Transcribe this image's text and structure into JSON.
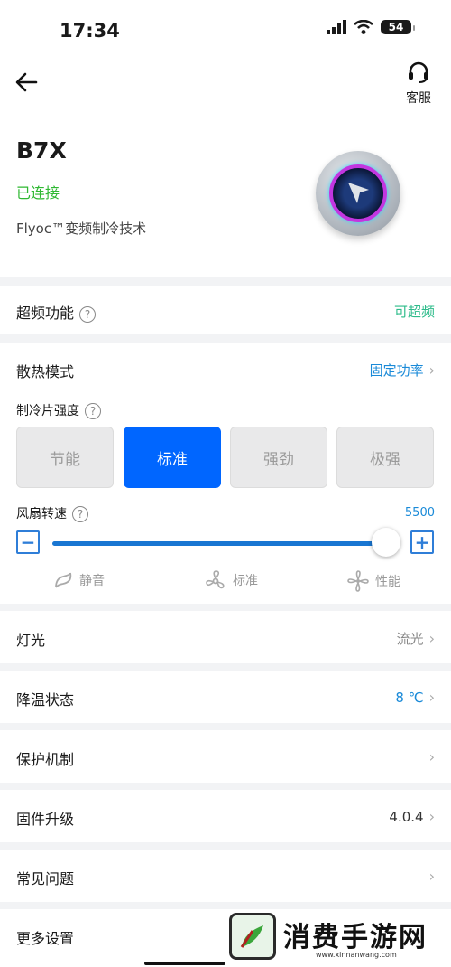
{
  "status_bar": {
    "time": "17:34",
    "battery": "54"
  },
  "header": {
    "service_label": "客服",
    "device_name": "B7X",
    "connection_status": "已连接",
    "tech_label": "Flyoc™变频制冷技术"
  },
  "overclock": {
    "label": "超频功能",
    "value": "可超频",
    "value_color": "#2dbb8a"
  },
  "cooling": {
    "mode_label": "散热模式",
    "mode_value": "固定功率",
    "strength_label": "制冷片强度",
    "strength_options": [
      "节能",
      "标准",
      "强劲",
      "极强"
    ],
    "strength_selected": "标准",
    "fan_label": "风扇转速",
    "fan_value": "5500",
    "fan_level": 1.0,
    "fan_presets": [
      "静音",
      "标准",
      "性能"
    ]
  },
  "rows": [
    {
      "label": "灯光",
      "value": "流光"
    },
    {
      "label": "降温状态",
      "value": "8 ℃"
    },
    {
      "label": "保护机制",
      "value": ""
    },
    {
      "label": "固件升级",
      "value": "4.0.4"
    },
    {
      "label": "常见问题",
      "value": ""
    },
    {
      "label": "更多设置",
      "value": ""
    }
  ],
  "watermark": {
    "text": "消费手游网",
    "url": "www.xinnanwang.com"
  },
  "colors": {
    "accent": "#0066ff",
    "link": "#1a8ad8",
    "connected": "#2fb832",
    "slider": "#1976d2"
  }
}
